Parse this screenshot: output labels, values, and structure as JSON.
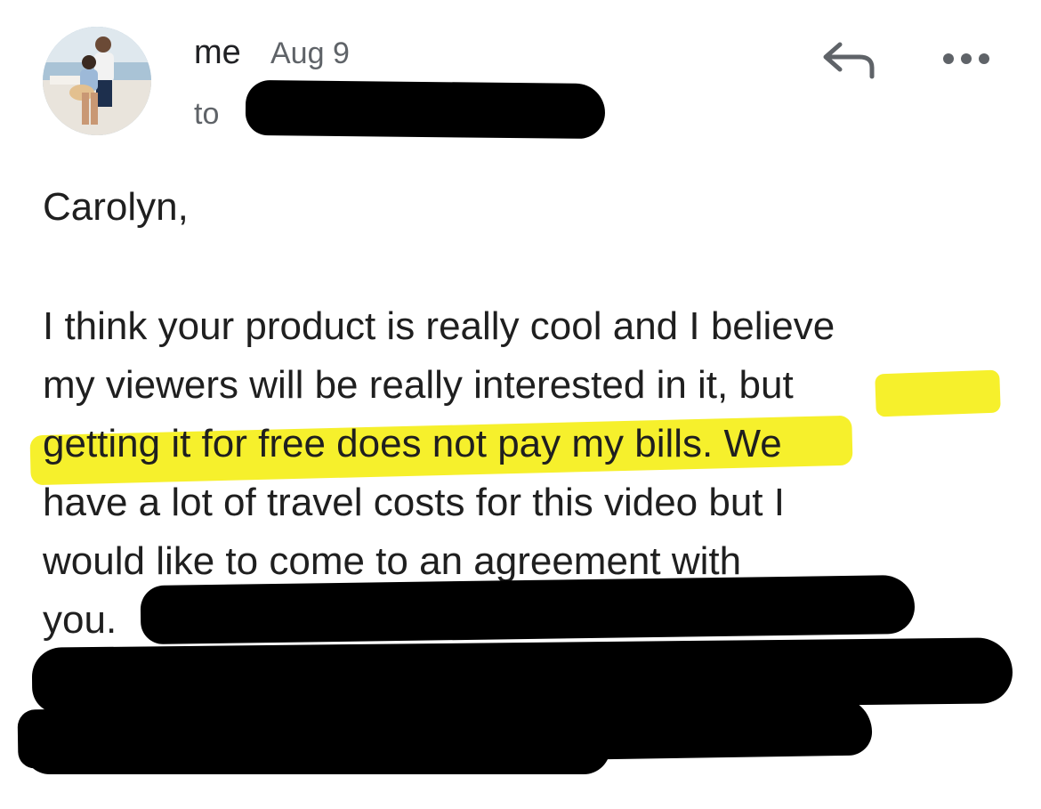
{
  "header": {
    "sender": "me",
    "date": "Aug 9",
    "to_prefix": "to"
  },
  "actions": {
    "reply_icon": "reply-arrow-icon",
    "more_icon": "more-horizontal-icon"
  },
  "message": {
    "greeting": "Carolyn,",
    "lines": [
      "I think your product is really cool and I believe",
      "my viewers will be really interested in it,",
      "but",
      "getting it for free does not pay my bills",
      ". We",
      "have a lot of travel costs for this video but I",
      "would like to come to an agreement with",
      "you."
    ]
  },
  "colors": {
    "highlight": "#f5ef1a",
    "redaction": "#000000",
    "meta_text": "#5f6368"
  }
}
